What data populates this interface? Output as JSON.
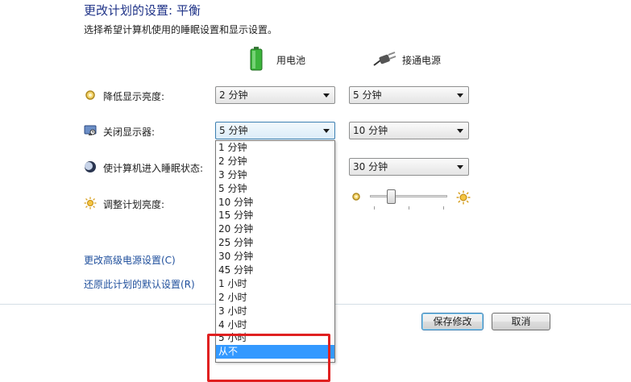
{
  "header": {
    "title": "更改计划的设置: 平衡",
    "subtitle": "选择希望计算机使用的睡眠设置和显示设置。"
  },
  "columns": {
    "battery": "用电池",
    "plugged_in": "接通电源"
  },
  "rows": {
    "dim_display": {
      "label": "降低显示亮度:",
      "battery_value": "2 分钟",
      "plugged_value": "5 分钟",
      "icon": "dim-icon"
    },
    "turn_off_display": {
      "label": "关闭显示器:",
      "battery_value": "5 分钟",
      "plugged_value": "10 分钟",
      "icon": "monitor-icon"
    },
    "sleep": {
      "label": "使计算机进入睡眠状态:",
      "plugged_value": "30 分钟",
      "icon": "moon-icon"
    },
    "brightness": {
      "label": "调整计划亮度:",
      "level": 0.25,
      "icon": "sun-icon"
    }
  },
  "dropdown": {
    "options": [
      "1 分钟",
      "2 分钟",
      "3 分钟",
      "5 分钟",
      "10 分钟",
      "15 分钟",
      "20 分钟",
      "25 分钟",
      "30 分钟",
      "45 分钟",
      "1 小时",
      "2 小时",
      "3 小时",
      "4 小时",
      "5 小时",
      "从不"
    ],
    "highlighted": "从不"
  },
  "links": {
    "advanced": "更改高级电源设置(C)",
    "restore": "还原此计划的默认设置(R)"
  },
  "buttons": {
    "save": "保存修改",
    "cancel": "取消"
  },
  "colors": {
    "title": "#1e3287",
    "link": "#1f4f9c",
    "selection": "#3399ff",
    "annotation_box": "#e02020",
    "battery_green": "#3cb43c"
  }
}
